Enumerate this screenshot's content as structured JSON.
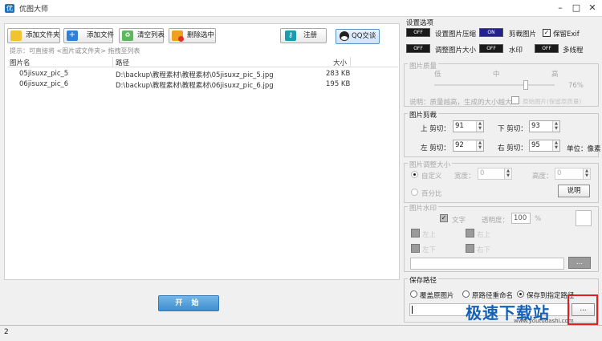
{
  "app": {
    "title": "优图大师"
  },
  "toolbar": {
    "add_folder": "添加文件夹",
    "add_file": "添加文件",
    "clear_list": "清空列表",
    "delete_selected": "删除选中",
    "register": "注册",
    "qq_chat": "QQ交谈"
  },
  "hint": "提示：可直接将 <图片或文件夹> 拖拽至列表",
  "table": {
    "columns": [
      "图片名",
      "路径",
      "大小"
    ],
    "rows": [
      {
        "name": "05jisuxz_pic_5",
        "path": "D:\\backup\\教程素材\\教程素材\\05jisuxz_pic_5.jpg",
        "size": "283 KB"
      },
      {
        "name": "06jisuxz_pic_6",
        "path": "D:\\backup\\教程素材\\教程素材\\06jisuxz_pic_6.jpg",
        "size": "195 KB"
      }
    ]
  },
  "start_button": "开 始",
  "settings": {
    "title": "设置选项",
    "compress": {
      "toggle": "OFF",
      "label": "设置图片压缩"
    },
    "crop": {
      "toggle": "ON",
      "label": "剪裁图片"
    },
    "keep_exif": {
      "label": "保留Exif",
      "checked": true
    },
    "resize": {
      "toggle": "OFF",
      "label": "调整图片大小"
    },
    "watermark": {
      "toggle": "OFF",
      "label": "水印"
    },
    "multithread": {
      "toggle": "OFF",
      "label": "多线程"
    }
  },
  "quality": {
    "title": "图片质量",
    "low": "低",
    "mid": "中",
    "high": "高",
    "value_text": "76%",
    "level": 0.76,
    "note": "说明：质量越高，生成的大小越大",
    "keep_quality": "原始图片(保留原质量)"
  },
  "crop_section": {
    "title": "图片剪裁",
    "top_label": "上 剪切：",
    "top": "91",
    "bottom_label": "下 剪切：",
    "bottom": "93",
    "left_label": "左 剪切：",
    "left": "92",
    "right_label": "右 剪切：",
    "right": "95",
    "unit": "单位：像素"
  },
  "resize_section": {
    "title": "图片调整大小",
    "custom": "自定义",
    "width_label": "宽度：",
    "width": "0",
    "height_label": "高度：",
    "height": "0",
    "percent": "百分比",
    "explain": "说明"
  },
  "watermark_section": {
    "title": "图片水印",
    "text": "文字",
    "opacity_label": "透明度：",
    "opacity": "100",
    "opacity_unit": "%",
    "pos_top_left": "左上",
    "pos_top_right": "右上",
    "pos_bottom_left": "左下",
    "pos_bottom_right": "右下",
    "browse": "..."
  },
  "save_section": {
    "title": "保存路径",
    "overwrite": "覆盖原图片",
    "rename": "原路径重命名",
    "to_path": "保存到指定路径",
    "browse": "..."
  },
  "status": {
    "count": "2"
  },
  "watermark_overlay": {
    "title": "极速下载站",
    "url": "www.youtudashi.com"
  },
  "colors": {
    "accent": "#3d8ed0",
    "toggle_on": "#22228a",
    "highlight": "#e02020"
  }
}
